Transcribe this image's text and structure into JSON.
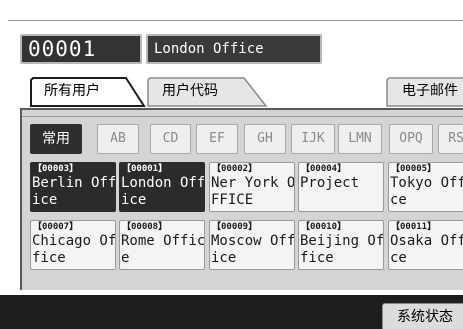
{
  "header": {
    "registration_number": "00001",
    "registration_name": "London Office"
  },
  "tabs": [
    {
      "label": "所有用户",
      "active": true
    },
    {
      "label": "用户代码",
      "active": false
    },
    {
      "label": "电子邮件",
      "active": false
    }
  ],
  "index_keys": [
    {
      "label": "常用",
      "active": true
    },
    {
      "label": "AB",
      "active": false
    },
    {
      "label": "CD",
      "active": false
    },
    {
      "label": "EF",
      "active": false
    },
    {
      "label": "GH",
      "active": false
    },
    {
      "label": "IJK",
      "active": false
    },
    {
      "label": "LMN",
      "active": false
    },
    {
      "label": "OPQ",
      "active": false
    },
    {
      "label": "RST",
      "active": false
    }
  ],
  "entries": [
    {
      "number": "【00003】",
      "name": "Berlin Off\nice",
      "selected": true
    },
    {
      "number": "【00001】",
      "name": "London Off\nice",
      "selected": true
    },
    {
      "number": "【00002】",
      "name": "Ner York O\nFFICE",
      "selected": false
    },
    {
      "number": "【00004】",
      "name": "Project",
      "selected": false
    },
    {
      "number": "【00005】",
      "name": "Tokyo Off\nce",
      "selected": false
    },
    {
      "number": "【00007】",
      "name": "Chicago Of\nfice",
      "selected": false
    },
    {
      "number": "【00008】",
      "name": "Rome Offic\ne",
      "selected": false
    },
    {
      "number": "【00009】",
      "name": "Moscow Off\nice",
      "selected": false
    },
    {
      "number": "【00010】",
      "name": "Beijing Of\nfice",
      "selected": false
    },
    {
      "number": "【00011】",
      "name": "Osaka Off\nce",
      "selected": false
    }
  ],
  "footer": {
    "status_button": "系统状态"
  }
}
